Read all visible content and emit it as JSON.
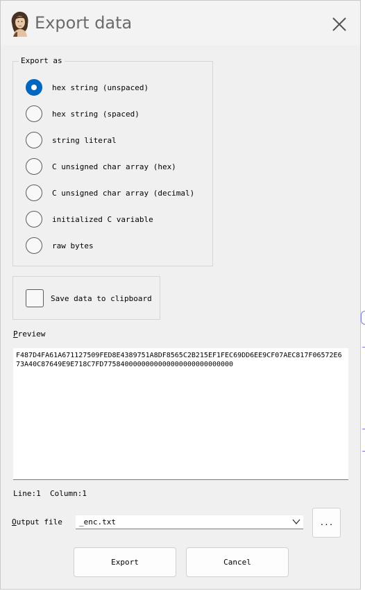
{
  "window": {
    "title": "Export data"
  },
  "export_as": {
    "label": "Export as",
    "options": [
      {
        "label": "hex string (unspaced)",
        "checked": true
      },
      {
        "label": "hex string (spaced)",
        "checked": false
      },
      {
        "label": "string literal",
        "checked": false
      },
      {
        "label": "C unsigned char array (hex)",
        "checked": false
      },
      {
        "label": "C unsigned char array (decimal)",
        "checked": false
      },
      {
        "label": "initialized C variable",
        "checked": false
      },
      {
        "label": "raw bytes",
        "checked": false
      }
    ]
  },
  "clipboard": {
    "label": "Save data to clipboard",
    "checked": false
  },
  "preview": {
    "label_accel": "P",
    "label_rest": "review",
    "text": "F487D4FA61A671127509FED8E4389751A8DF8565C2B215EF1FEC69DD6EE9CF07AEC817F06572E673A40C87649E9E718C7FD7758400000000000000000000000000"
  },
  "status": {
    "line": "Line:1",
    "column": "Column:1"
  },
  "output_file": {
    "label_accel": "O",
    "label_rest": "utput file",
    "value": "_enc.txt",
    "browse_label": "..."
  },
  "buttons": {
    "export": "Export",
    "cancel": "Cancel"
  },
  "colors": {
    "accent": "#0067c0",
    "background": "#f0f0f0"
  },
  "icons": {
    "close": "close-icon",
    "dropdown": "chevron-down-icon",
    "app": "portrait-icon"
  }
}
